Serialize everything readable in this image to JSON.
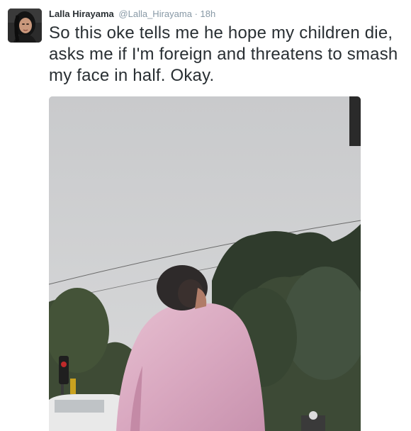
{
  "tweet": {
    "display_name": "Lalla Hirayama",
    "handle": "@Lalla_Hirayama",
    "separator": "·",
    "timestamp": "18h",
    "text": "So this oke tells me he hope my children die, asks me if I'm foreign and threatens to smash my face in half. Okay."
  },
  "icons": {
    "avatar": "profile-photo",
    "media": "attached-photo"
  },
  "colors": {
    "text": "#292f33",
    "muted": "#8899a6"
  }
}
